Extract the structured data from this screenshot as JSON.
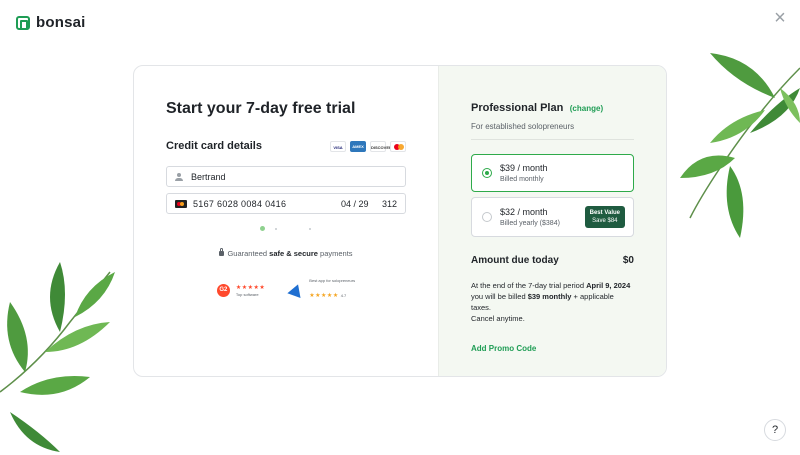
{
  "brand": {
    "name": "bonsai"
  },
  "trial": {
    "title": "Start your 7-day free trial",
    "cc_label": "Credit card details",
    "card_brands": [
      "VISA",
      "AMEX",
      "DISCOVER",
      "MC"
    ],
    "name_value": "Bertrand",
    "card_number": "5167 6028 0084 0416",
    "expiry": "04 / 29",
    "cvc": "312",
    "secure_prefix": "Guaranteed ",
    "secure_bold": "safe & secure",
    "secure_suffix": " payments",
    "g2_label": "G2",
    "g2_stars": "★★★★★",
    "g2_caption": "Top software",
    "capterra_caption": "Best app for solopreneurs",
    "capterra_stars": "★★★★★",
    "capterra_rating": "4.7"
  },
  "plan": {
    "title": "Professional Plan",
    "change": "(change)",
    "subtitle": "For established solopreneurs",
    "options": [
      {
        "price": "$39 / month",
        "billing": "Billed monthly",
        "selected": true
      },
      {
        "price": "$32 / month",
        "billing": "Billed yearly ($384)",
        "selected": false,
        "badge_line1": "Best Value",
        "badge_line2": "Save $84"
      }
    ],
    "amount_label": "Amount due today",
    "amount_value": "$0",
    "note_1": "At the end of the 7-day trial period ",
    "note_date": "April 9, 2024",
    "note_2": "you will be billed ",
    "note_price": "$39 monthly",
    "note_3": " + applicable taxes.",
    "note_4": "Cancel anytime.",
    "promo": "Add Promo Code"
  },
  "help": {
    "label": "?"
  },
  "close": {
    "label": "×"
  },
  "colors": {
    "accent": "#1f9d55",
    "selected_border": "#2eaa4a",
    "badge_bg": "#1f5b40",
    "panel_bg": "#f4f8f2"
  }
}
